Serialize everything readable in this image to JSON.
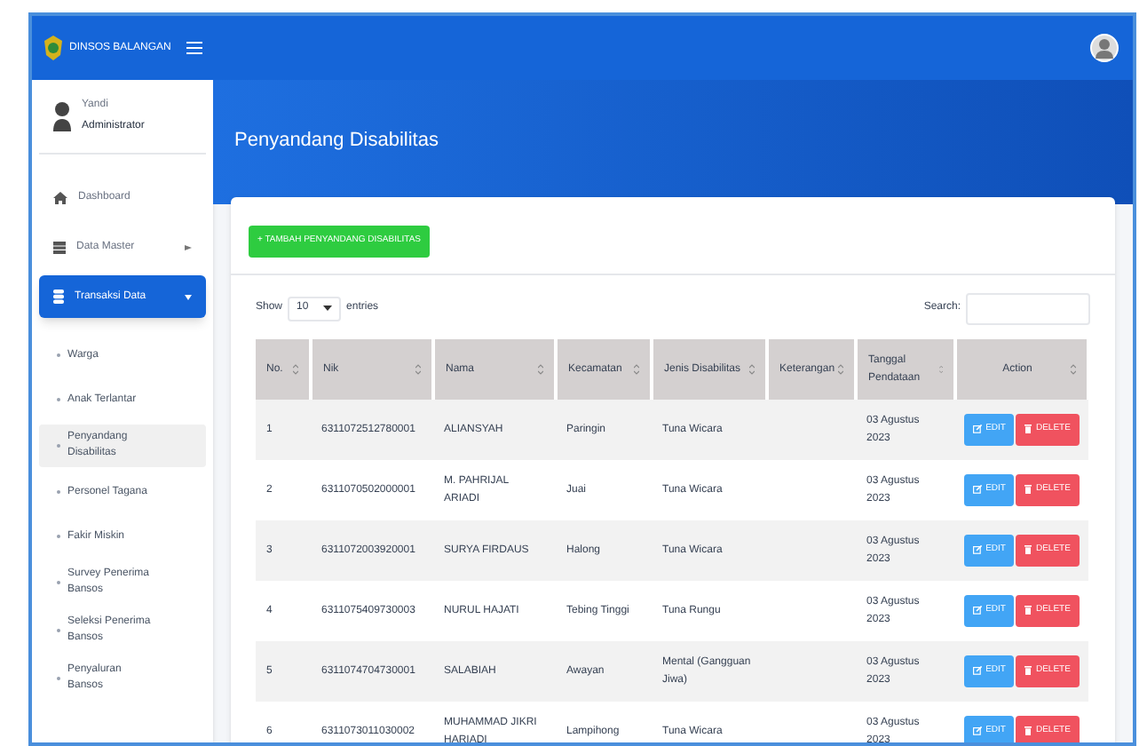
{
  "app": {
    "brand": "DINSOS BALANGAN"
  },
  "user": {
    "name": "Yandi",
    "role": "Administrator"
  },
  "sidebar": {
    "items": [
      {
        "label": "Dashboard",
        "selected": false
      },
      {
        "label": "Data Master",
        "selected": false,
        "expanded": false
      },
      {
        "label": "Transaksi Data",
        "selected": true,
        "expanded": true,
        "children": [
          {
            "label": "Warga",
            "selected": false
          },
          {
            "label": "Anak Terlantar",
            "selected": false
          },
          {
            "label": "Penyandang Disabilitas",
            "selected": true
          },
          {
            "label": "Personel Tagana",
            "selected": false
          },
          {
            "label": "Fakir Miskin",
            "selected": false
          },
          {
            "label": "Survey Penerima Bansos",
            "selected": false
          },
          {
            "label": "Seleksi Penerima Bansos",
            "selected": false
          },
          {
            "label": "Penyaluran Bansos",
            "selected": false
          }
        ]
      }
    ]
  },
  "page": {
    "title": "Penyandang Disabilitas"
  },
  "add_button": "+ TAMBAH PENYANDANG DISABILITAS",
  "length_control": {
    "before": "Show",
    "value": "10",
    "after": "entries"
  },
  "search": {
    "label": "Search:"
  },
  "table": {
    "columns": [
      "No.",
      "Nik",
      "Nama",
      "Kecamatan",
      "Jenis Disabilitas",
      "Keterangan",
      "Tanggal Pendataan",
      "Action"
    ],
    "rows": [
      {
        "cells": [
          "1",
          "6311072512780001",
          "ALIANSYAH",
          "Paringin",
          "Tuna Wicara",
          "",
          "03 Agustus 2023"
        ],
        "actions": [
          "EDIT",
          "DELETE"
        ]
      },
      {
        "cells": [
          "2",
          "6311070502000001",
          "M. PAHRIJAL ARIADI",
          "Juai",
          "Tuna Wicara",
          "",
          "03 Agustus 2023"
        ],
        "actions": [
          "EDIT",
          "DELETE"
        ]
      },
      {
        "cells": [
          "3",
          "6311072003920001",
          "SURYA FIRDAUS",
          "Halong",
          "Tuna Wicara",
          "",
          "03 Agustus 2023"
        ],
        "actions": [
          "EDIT",
          "DELETE"
        ]
      },
      {
        "cells": [
          "4",
          "6311075409730003",
          "NURUL HAJATI",
          "Tebing Tinggi",
          "Tuna Rungu",
          "",
          "03 Agustus 2023"
        ],
        "actions": [
          "EDIT",
          "DELETE"
        ]
      },
      {
        "cells": [
          "5",
          "6311074704730001",
          "SALABIAH",
          "Awayan",
          "Mental (Gangguan Jiwa)",
          "",
          "03 Agustus 2023"
        ],
        "actions": [
          "EDIT",
          "DELETE"
        ]
      },
      {
        "cells": [
          "6",
          "6311073011030002",
          "MUHAMMAD JIKRI HARIADI",
          "Lampihong",
          "Tuna Wicara",
          "",
          "03 Agustus 2023"
        ],
        "actions": [
          "EDIT",
          "DELETE"
        ]
      }
    ]
  }
}
